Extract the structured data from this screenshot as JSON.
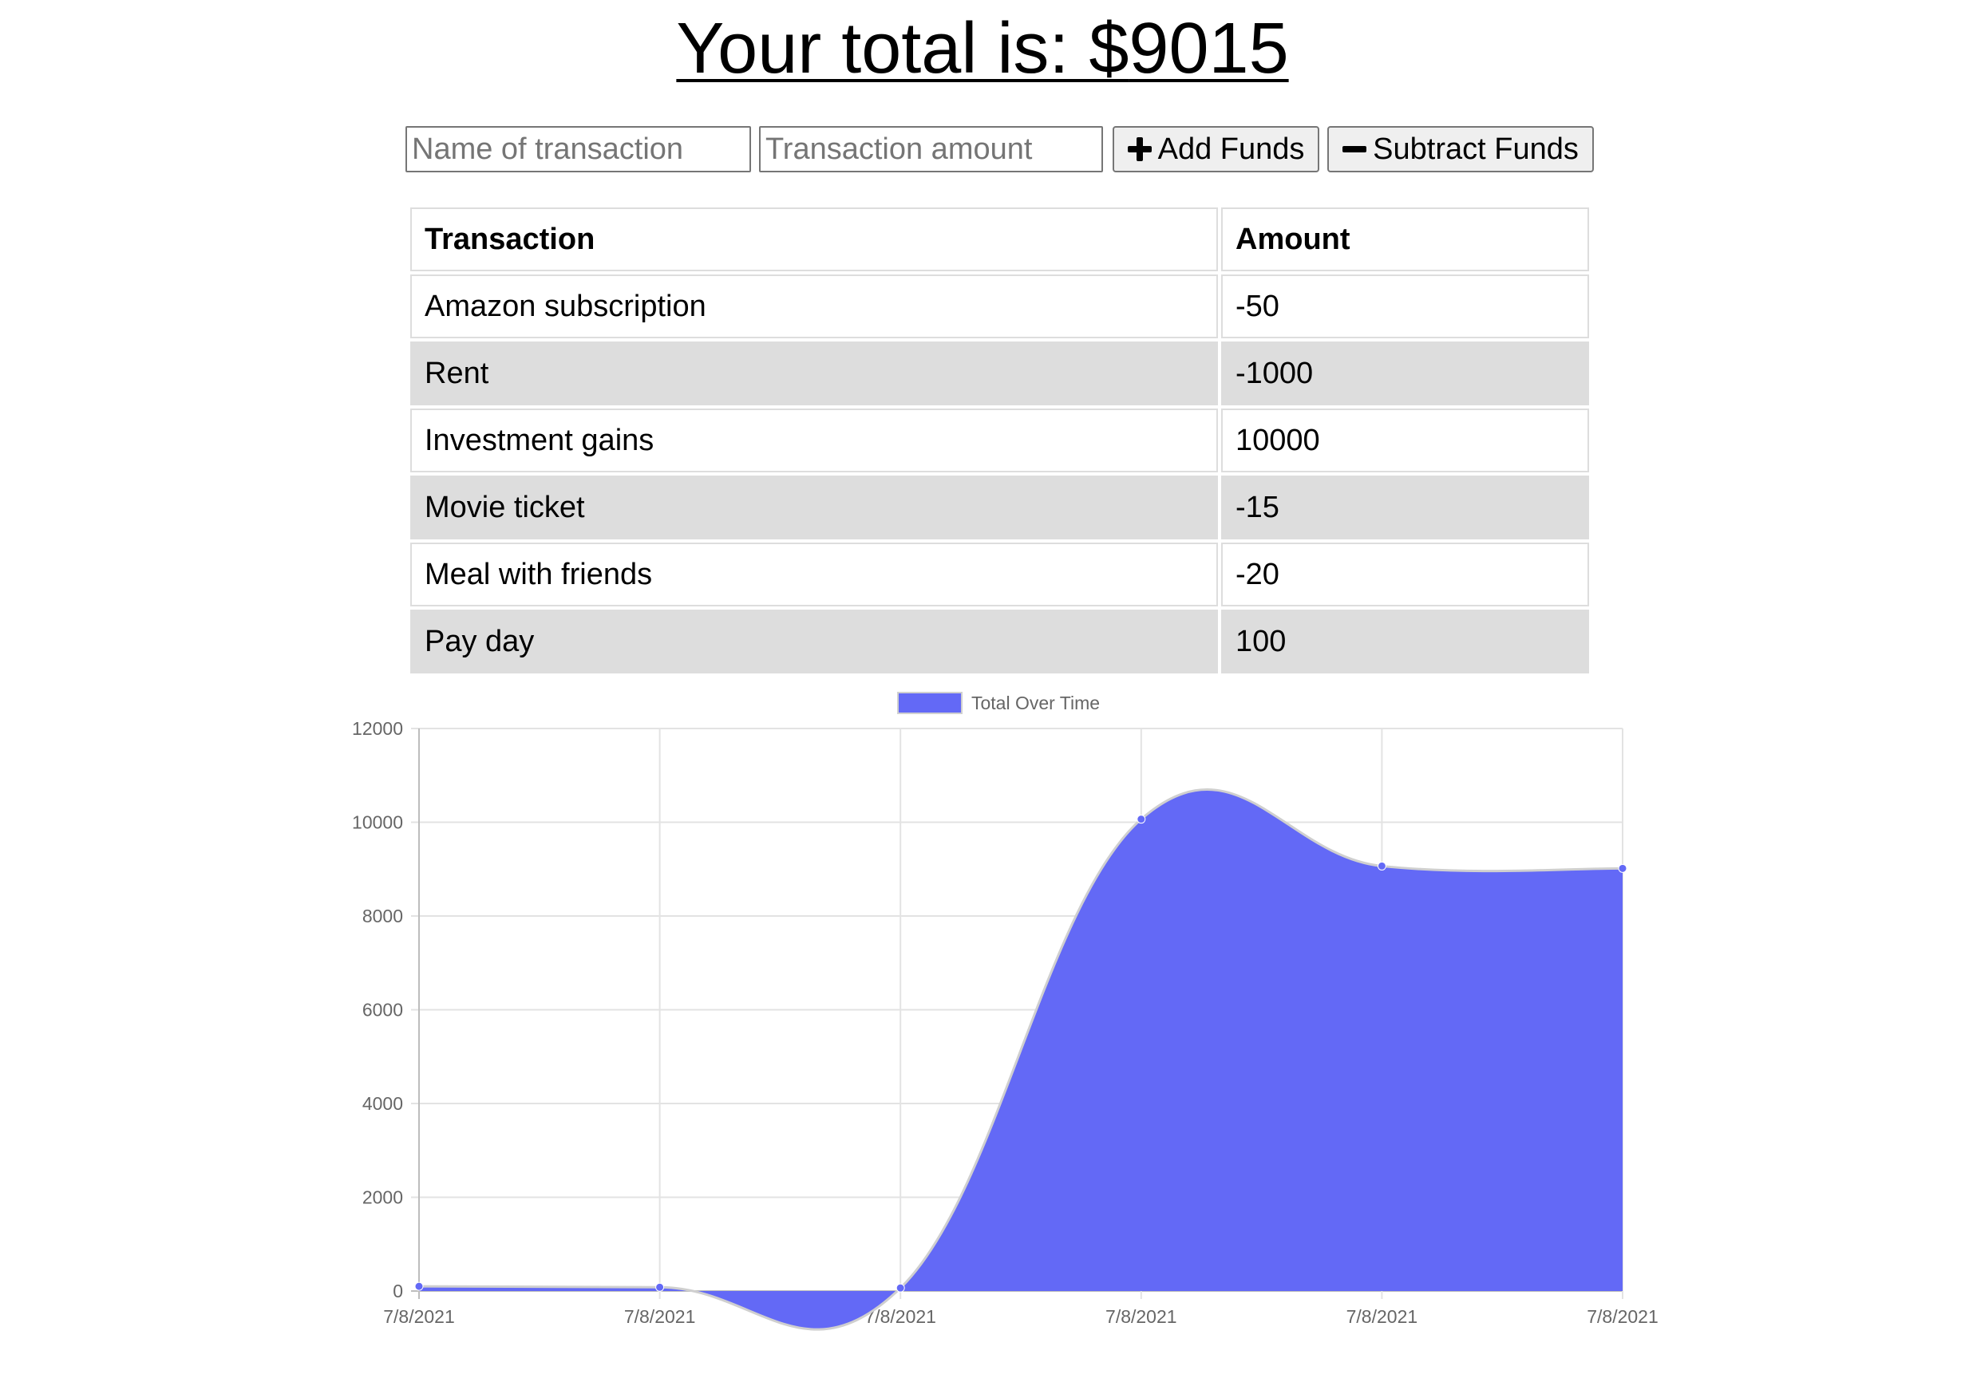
{
  "header": {
    "total_label": "Your total is: $",
    "total_value": "9015"
  },
  "form": {
    "name_placeholder": "Name of transaction",
    "amount_placeholder": "Transaction amount",
    "add_label": "Add Funds",
    "subtract_label": "Subtract Funds",
    "add_icon": "plus-icon",
    "subtract_icon": "minus-icon"
  },
  "table": {
    "headers": [
      "Transaction",
      "Amount"
    ],
    "rows": [
      {
        "name": "Amazon subscription",
        "amount": "-50"
      },
      {
        "name": "Rent",
        "amount": "-1000"
      },
      {
        "name": "Investment gains",
        "amount": "10000"
      },
      {
        "name": "Movie ticket",
        "amount": "-15"
      },
      {
        "name": "Meal with friends",
        "amount": "-20"
      },
      {
        "name": "Pay day",
        "amount": "100"
      }
    ],
    "stripe_color": "#dddddd"
  },
  "chart_data": {
    "type": "area",
    "legend_position": "top",
    "grid": true,
    "x": [
      "7/8/2021",
      "7/8/2021",
      "7/8/2021",
      "7/8/2021",
      "7/8/2021",
      "7/8/2021"
    ],
    "series": [
      {
        "name": "Total Over Time",
        "values": [
          100,
          80,
          65,
          10065,
          9065,
          9015
        ],
        "color": "#6369f6"
      }
    ],
    "yticks": [
      "0",
      "2000",
      "4000",
      "6000",
      "8000",
      "10000",
      "12000"
    ],
    "ylim": [
      0,
      12000
    ]
  }
}
